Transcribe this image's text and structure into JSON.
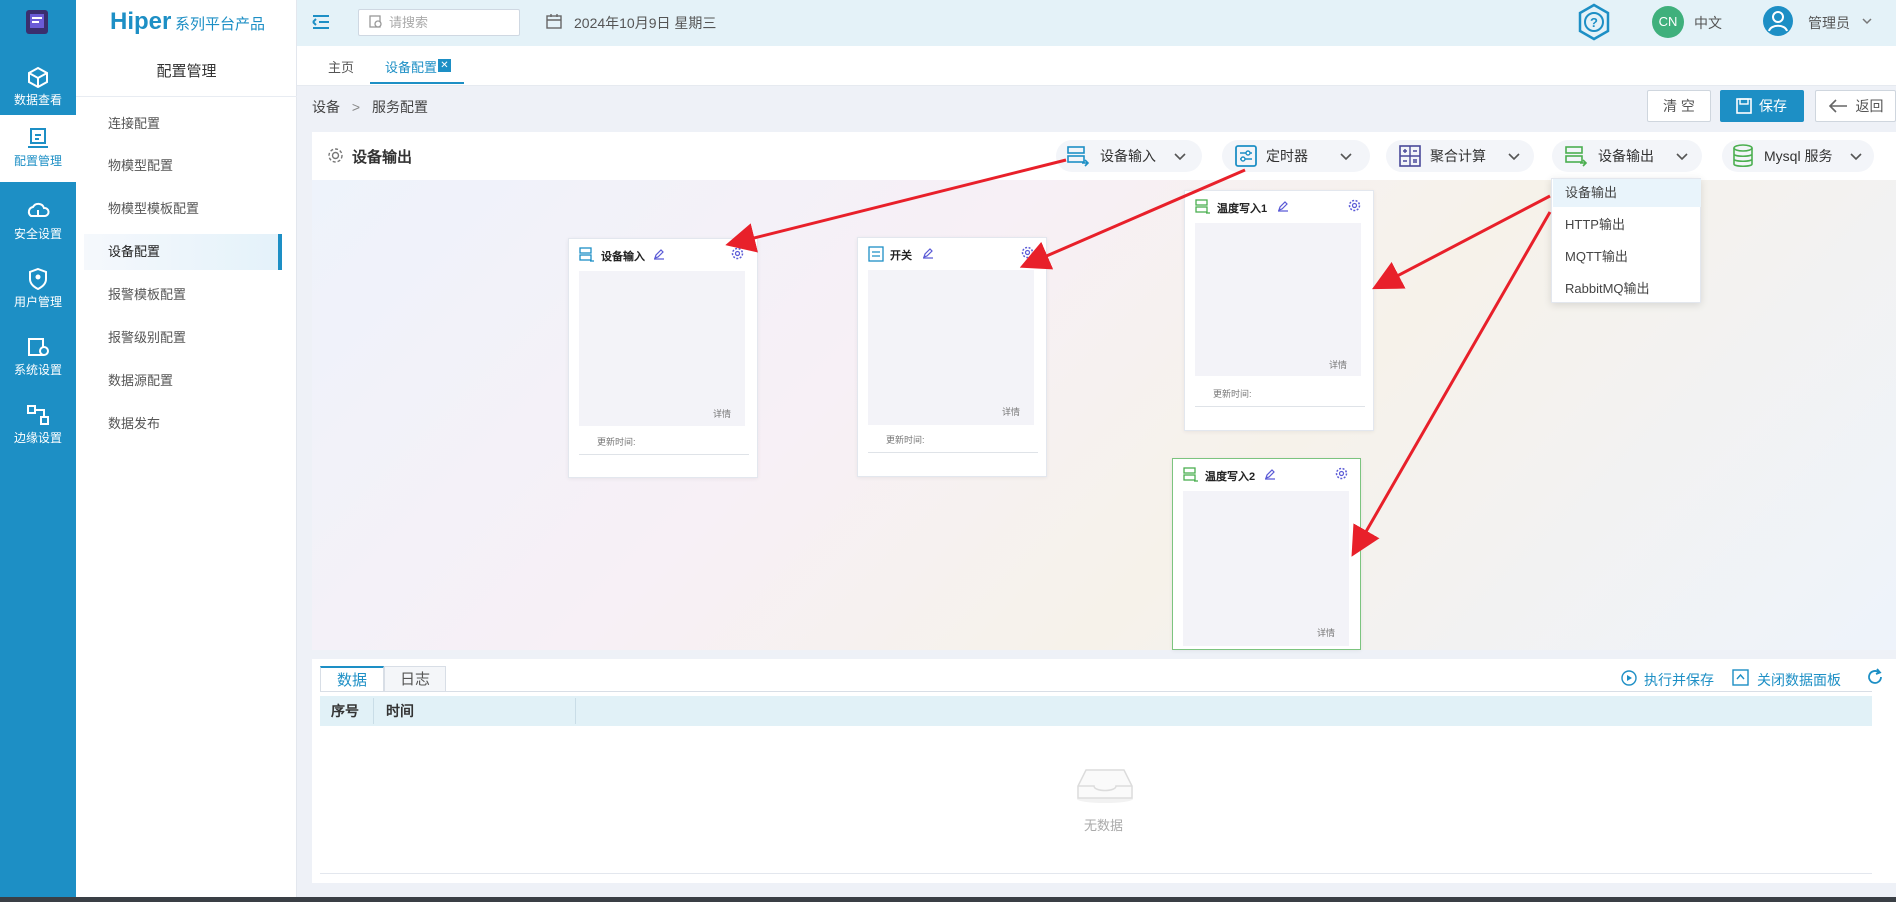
{
  "brand": {
    "name": "Hiper",
    "suffix": "系列平台产品"
  },
  "rail": {
    "items": [
      {
        "label": "数据查看",
        "icon": "cube-icon"
      },
      {
        "label": "配置管理",
        "icon": "config-icon"
      },
      {
        "label": "安全设置",
        "icon": "cloud-shield-icon"
      },
      {
        "label": "用户管理",
        "icon": "user-shield-icon"
      },
      {
        "label": "系统设置",
        "icon": "system-gear-icon"
      },
      {
        "label": "边缘设置",
        "icon": "edge-nodes-icon"
      }
    ]
  },
  "sidebar": {
    "title": "配置管理",
    "items": [
      "连接配置",
      "物模型配置",
      "物模型模板配置",
      "设备配置",
      "报警模板配置",
      "报警级别配置",
      "数据源配置",
      "数据发布"
    ]
  },
  "topbar": {
    "search_placeholder": "请搜索",
    "date": "2024年10月9日 星期三",
    "lang_badge": "CN",
    "lang": "中文",
    "user": "管理员"
  },
  "tabs": {
    "home": "主页",
    "active": "设备配置"
  },
  "breadcrumb": {
    "root": "设备",
    "sep": ">",
    "current": "服务配置"
  },
  "actions": {
    "clear": "清 空",
    "save": "保存",
    "back": "返回"
  },
  "panel": {
    "title": "设备输出"
  },
  "toolbox": {
    "input": "设备输入",
    "timer": "定时器",
    "aggregate": "聚合计算",
    "output": "设备输出",
    "mysql": "Mysql 服务"
  },
  "output_menu": [
    "设备输出",
    "HTTP输出",
    "MQTT输出",
    "RabbitMQ输出"
  ],
  "nodes": {
    "n1": {
      "title": "设备输入",
      "detail": "详情",
      "updated": "更新时间:"
    },
    "n2": {
      "title": "开关",
      "detail": "详情",
      "updated": "更新时间:"
    },
    "n3": {
      "title": "温度写入1",
      "detail": "详情",
      "updated": "更新时间:"
    },
    "n4": {
      "title": "温度写入2",
      "detail": "详情"
    }
  },
  "datapanel": {
    "tab_data": "数据",
    "tab_log": "日志",
    "run_save": "执行并保存",
    "close_panel": "关闭数据面板",
    "col_index": "序号",
    "col_time": "时间",
    "empty": "无数据"
  },
  "colors": {
    "primary": "#1d8fc5",
    "annotation_arrow": "#e8202a",
    "node_output_accent": "#4caf50"
  }
}
